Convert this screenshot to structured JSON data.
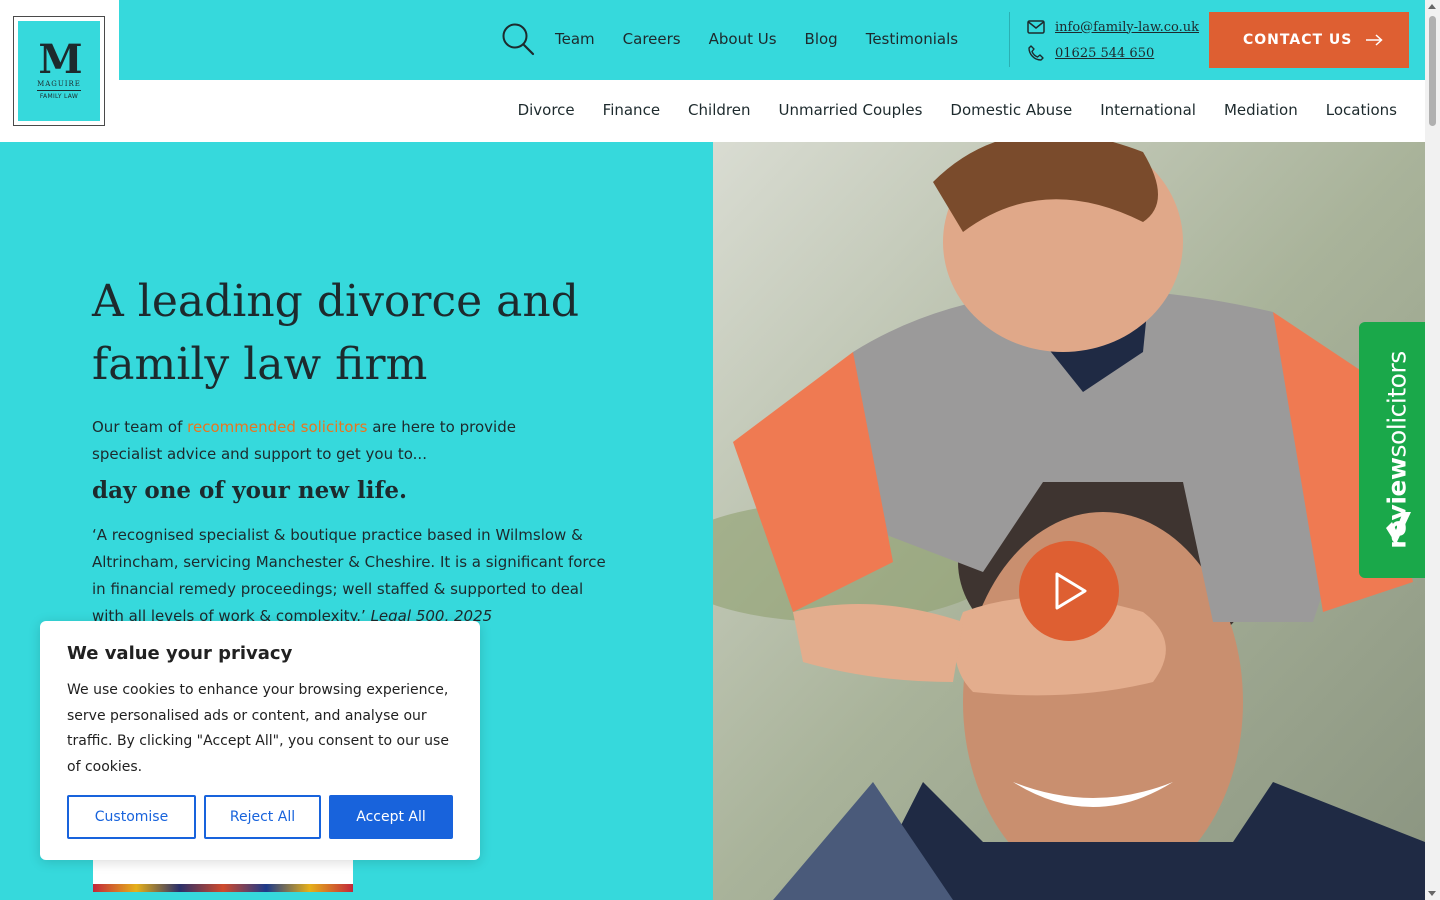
{
  "logo": {
    "mark": "M",
    "name": "MAGUIRE",
    "sub": "FAMILY LAW"
  },
  "topbar": {
    "links": [
      "Team",
      "Careers",
      "About Us",
      "Blog",
      "Testimonials"
    ],
    "email": "info@family-law.co.uk",
    "phone": "01625 544 650",
    "contact_label": "CONTACT US"
  },
  "nav": {
    "items": [
      "Divorce",
      "Finance",
      "Children",
      "Unmarried Couples",
      "Domestic Abuse",
      "International",
      "Mediation",
      "Locations"
    ]
  },
  "hero": {
    "title": "A leading divorce and family law firm",
    "intro_before": "Our team of ",
    "intro_link": "recommended solicitors",
    "intro_after": " are here to provide specialist advice and support to get you to...",
    "subheading": "day one of your new life.",
    "quote": "‘A recognised specialist & boutique practice based in Wilmslow & Altrincham, servicing Manchester & Cheshire. It is a significant force in financial remedy proceedings; well staffed & supported to deal with all levels of work & complexity.’",
    "quote_source": "Legal 500, 2025"
  },
  "review_badge": {
    "bold": "review",
    "light": "solicitors"
  },
  "cookie": {
    "title": "We value your privacy",
    "body": "We use cookies to enhance your browsing experience, serve personalised ads or content, and analyse our traffic. By clicking \"Accept All\", you consent to our use of cookies.",
    "customise": "Customise",
    "reject": "Reject All",
    "accept": "Accept All"
  },
  "colors": {
    "brand_teal": "#36d9dc",
    "accent_orange": "#de5f32",
    "link_orange": "#e8751f",
    "review_green": "#1aa84a",
    "cookie_blue": "#1863dc"
  }
}
